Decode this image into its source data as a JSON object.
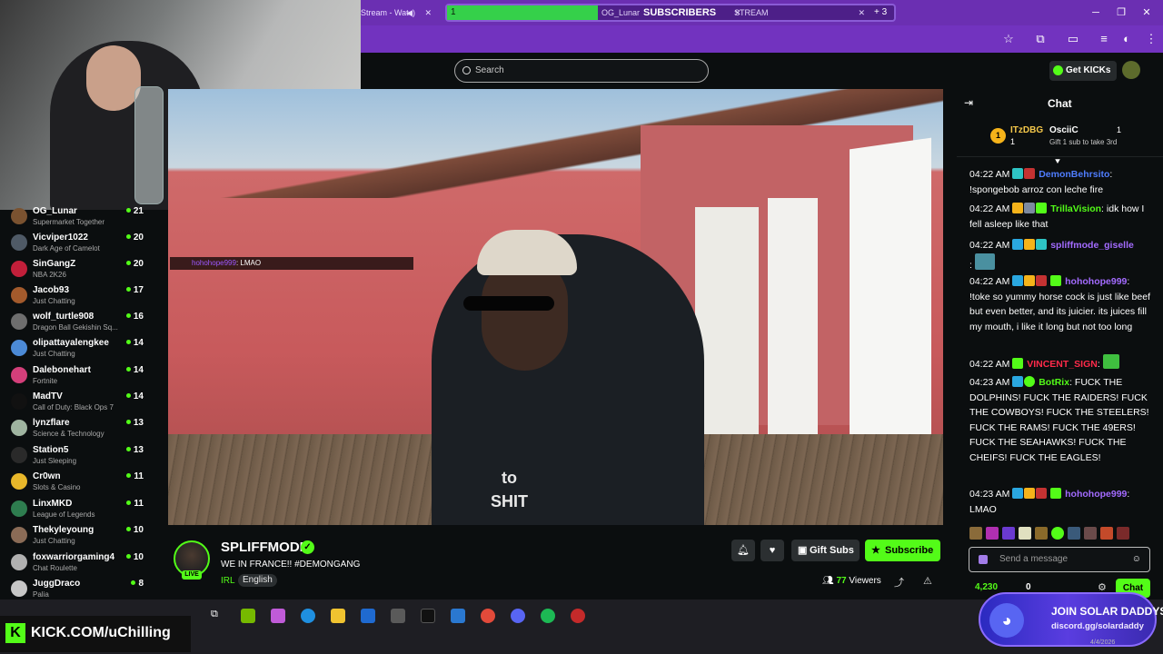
{
  "browser": {
    "tab_left_label": "Stream - Wat",
    "tab_group": {
      "green_label": "1",
      "og_label": "OG_Lunar",
      "subscribers_label": "SUBSCRIBERS",
      "stream_label": "STREAM",
      "count_label": "+ 3"
    }
  },
  "header": {
    "search_placeholder": "Search",
    "get_kicks_label": "Get KICKs"
  },
  "sidebar": {
    "channels": [
      {
        "name": "OG_Lunar",
        "game": "Supermarket Together",
        "viewers": "21",
        "color": "#7a5230"
      },
      {
        "name": "Vicviper1022",
        "game": "Dark Age of Camelot",
        "viewers": "20",
        "color": "#4f5a66"
      },
      {
        "name": "SinGangZ",
        "game": "NBA 2K26",
        "viewers": "20",
        "color": "#c21f3a"
      },
      {
        "name": "Jacob93",
        "game": "Just Chatting",
        "viewers": "17",
        "color": "#a35a2c"
      },
      {
        "name": "wolf_turtle908",
        "game": "Dragon Ball Gekishin Sq...",
        "viewers": "16",
        "color": "#6e6e6e"
      },
      {
        "name": "olipattayalengkee",
        "game": "Just Chatting",
        "viewers": "14",
        "color": "#4c8ad6"
      },
      {
        "name": "Dalebonehart",
        "game": "Fortnite",
        "viewers": "14",
        "color": "#d43f7a"
      },
      {
        "name": "MadTV",
        "game": "Call of Duty: Black Ops 7",
        "viewers": "14",
        "color": "#111111"
      },
      {
        "name": "lynzflare",
        "game": "Science & Technology",
        "viewers": "13",
        "color": "#9fb4a0"
      },
      {
        "name": "Station5",
        "game": "Just Sleeping",
        "viewers": "13",
        "color": "#2a2a2a"
      },
      {
        "name": "Cr0wn",
        "game": "Slots & Casino",
        "viewers": "11",
        "color": "#e8b72a"
      },
      {
        "name": "LinxMKD",
        "game": "League of Legends",
        "viewers": "11",
        "color": "#2e7d4f"
      },
      {
        "name": "Thekyleyoung",
        "game": "Just Chatting",
        "viewers": "10",
        "color": "#8a6b56"
      },
      {
        "name": "foxwarriorgaming4",
        "game": "Chat Roulette",
        "viewers": "10",
        "color": "#b0b0b0"
      },
      {
        "name": "JuggDraco",
        "game": "Palia",
        "viewers": "8",
        "color": "#c7c7c7"
      }
    ]
  },
  "video": {
    "overlay_user": "hohohope999",
    "overlay_text": ": LMAO",
    "shirt_line1": "to",
    "shirt_line2": "SHIT"
  },
  "stream": {
    "streamer": "SPLIFFMODE",
    "live_label": "LIVE",
    "title": "WE IN FRANCE!! #DEMONGANG",
    "category": "IRL",
    "language": "English",
    "viewers": "77",
    "viewers_label": "Viewers",
    "gift_subs_label": "Gift Subs",
    "subscribe_label": "Subscribe"
  },
  "chat": {
    "title": "Chat",
    "top_gifter": {
      "rank": "1",
      "name": "ITzDBG",
      "count": "1"
    },
    "second_gifter": {
      "name": "OsciiC",
      "count": "1",
      "sub": "Gift 1 sub to take 3rd"
    },
    "messages": [
      {
        "time": "04:22 AM",
        "user": "DemonBehrsito",
        "color": "#4f7dff",
        "text": "!spongebob arroz con leche fire"
      },
      {
        "time": "04:22 AM",
        "user": "TrillaVision",
        "color": "#53fc18",
        "text": "idk how I fell asleep like that"
      },
      {
        "time": "04:22 AM",
        "user": "spliffmode_giselle",
        "color": "#a36bff",
        "text": ""
      },
      {
        "time": "04:22 AM",
        "user": "hohohope999",
        "color": "#a36bff",
        "text": "!toke so yummy horse cock is just like beef but even better, and its juicier. its juices fill my mouth, i like it long but not too long"
      },
      {
        "time": "04:22 AM",
        "user": "VINCENT_SIGN",
        "color": "#ff2a4a",
        "text": ""
      },
      {
        "time": "04:23 AM",
        "user": "BotRix",
        "color": "#53fc18",
        "text": "FUCK THE DOLPHINS! FUCK THE RAIDERS! FUCK THE COWBOYS! FUCK THE STEELERS! FUCK THE RAMS! FUCK THE 49ERS! FUCK THE SEAHAWKS! FUCK THE CHEIFS! FUCK THE EAGLES!"
      },
      {
        "time": "04:23 AM",
        "user": "hohohope999",
        "color": "#a36bff",
        "text": "LMAO"
      }
    ],
    "input_placeholder": "Send a message",
    "kicks_count": "4,230",
    "zero_count": "0",
    "send_label": "Chat"
  },
  "taskbar": {
    "kick_url": "KICK.COM/uChilling",
    "discord_title": "JOIN SOLAR DADDYS",
    "discord_link": "discord.gg/solardaddy",
    "date": "4/4/2026"
  }
}
